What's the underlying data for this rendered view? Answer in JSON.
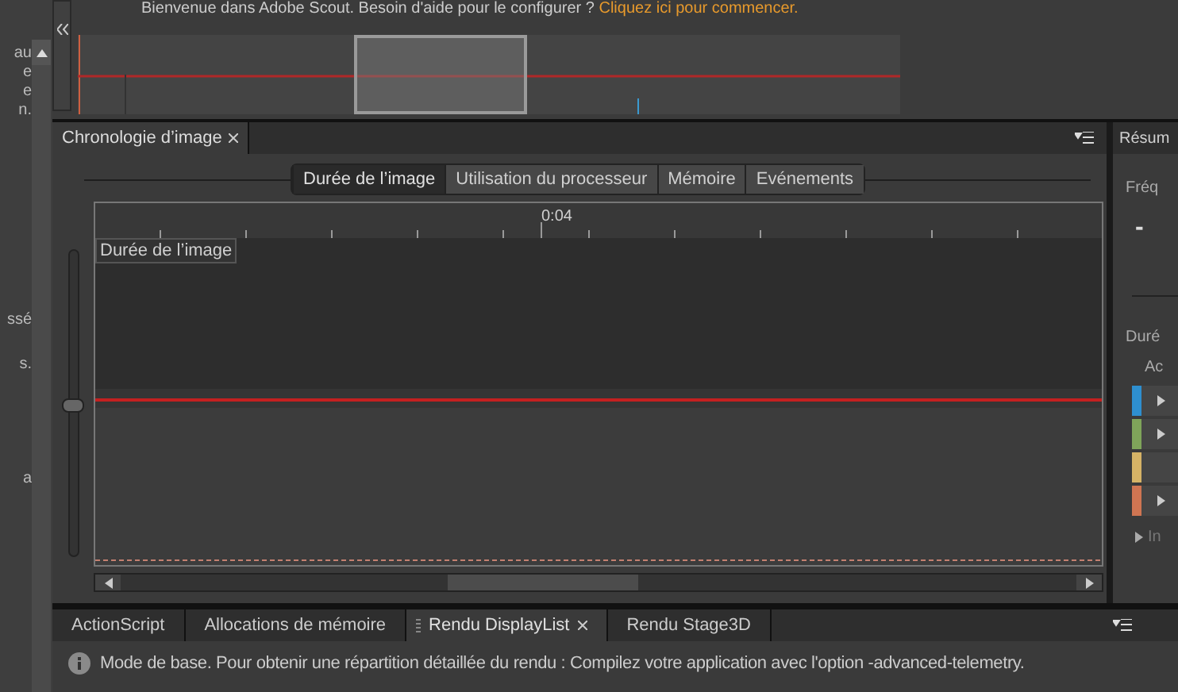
{
  "left_panel": {
    "text_fragments": [
      "au",
      "e",
      "e",
      "n.",
      "ssé",
      "s.",
      "a"
    ]
  },
  "welcome": {
    "message": "Bienvenue dans Adobe Scout. Besoin d'aide pour le configurer ?",
    "link": "Cliquez ici pour commencer."
  },
  "timeline_panel": {
    "tab": {
      "label": "Chronologie d’image",
      "selected": true
    },
    "view_tabs": [
      {
        "label": "Durée de l’image",
        "selected": true
      },
      {
        "label": "Utilisation du processeur",
        "selected": false
      },
      {
        "label": "Mémoire",
        "selected": false
      },
      {
        "label": "Evénements",
        "selected": false
      }
    ],
    "ruler_label": "0:04",
    "chart_label": "Durée de l’image",
    "zoom_slider": {
      "level": 0.5
    }
  },
  "summary_panel": {
    "title": "Résum",
    "frequency_label": "Fréq",
    "frequency_value": "-",
    "duration_label": "Duré",
    "column_header": "Ac",
    "categories": [
      {
        "color": "#2e8fcf",
        "expandable": true
      },
      {
        "color": "#7fa45a",
        "expandable": true
      },
      {
        "color": "#d6b366",
        "expandable": false
      },
      {
        "color": "#cf7552",
        "expandable": true
      }
    ],
    "footer": "In"
  },
  "bottom_panel": {
    "tabs": [
      {
        "label": "ActionScript",
        "selected": false
      },
      {
        "label": "Allocations de mémoire",
        "selected": false
      },
      {
        "label": "Rendu DisplayList",
        "selected": true
      },
      {
        "label": "Rendu Stage3D",
        "selected": false
      }
    ],
    "info": "Mode de base. Pour obtenir une répartition détaillée du rendu : Compilez votre application avec l'option -advanced-telemetry."
  }
}
